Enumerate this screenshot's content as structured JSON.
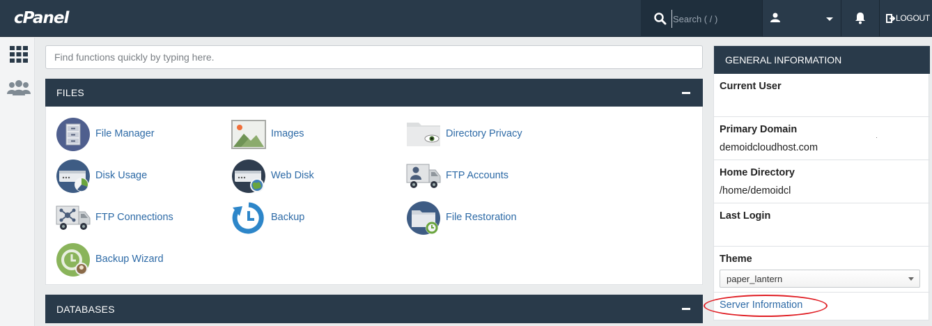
{
  "header": {
    "logo": "cPanel",
    "search_placeholder": "Search ( / )",
    "logout_label": "LOGOUT"
  },
  "rail": {
    "icons": [
      "apps-grid-icon",
      "users-icon"
    ]
  },
  "quick_search": {
    "placeholder": "Find functions quickly by typing here."
  },
  "files": {
    "title": "FILES",
    "items": [
      {
        "label": "File Manager",
        "icon": "file-cabinet-icon"
      },
      {
        "label": "Images",
        "icon": "image-icon"
      },
      {
        "label": "Directory Privacy",
        "icon": "folder-eye-icon"
      },
      {
        "label": "Disk Usage",
        "icon": "disk-usage-icon"
      },
      {
        "label": "Web Disk",
        "icon": "web-disk-icon"
      },
      {
        "label": "FTP Accounts",
        "icon": "ftp-accounts-icon"
      },
      {
        "label": "FTP Connections",
        "icon": "ftp-connections-icon"
      },
      {
        "label": "Backup",
        "icon": "backup-icon"
      },
      {
        "label": "File Restoration",
        "icon": "file-restoration-icon"
      },
      {
        "label": "Backup Wizard",
        "icon": "backup-wizard-icon"
      }
    ]
  },
  "databases": {
    "title": "DATABASES"
  },
  "general_info": {
    "title": "GENERAL INFORMATION",
    "current_user_label": "Current User",
    "current_user_value": "",
    "primary_domain_label": "Primary Domain",
    "primary_domain_value": "demoidcloudhost.com",
    "home_directory_label": "Home Directory",
    "home_directory_value": "/home/demoidcl",
    "last_login_label": "Last Login",
    "last_login_value": "",
    "theme_label": "Theme",
    "theme_value": "paper_lantern",
    "server_info_link": "Server Information"
  },
  "colors": {
    "header_bg": "#293a4a",
    "link": "#2d6aa6",
    "highlight": "#e01e24"
  }
}
